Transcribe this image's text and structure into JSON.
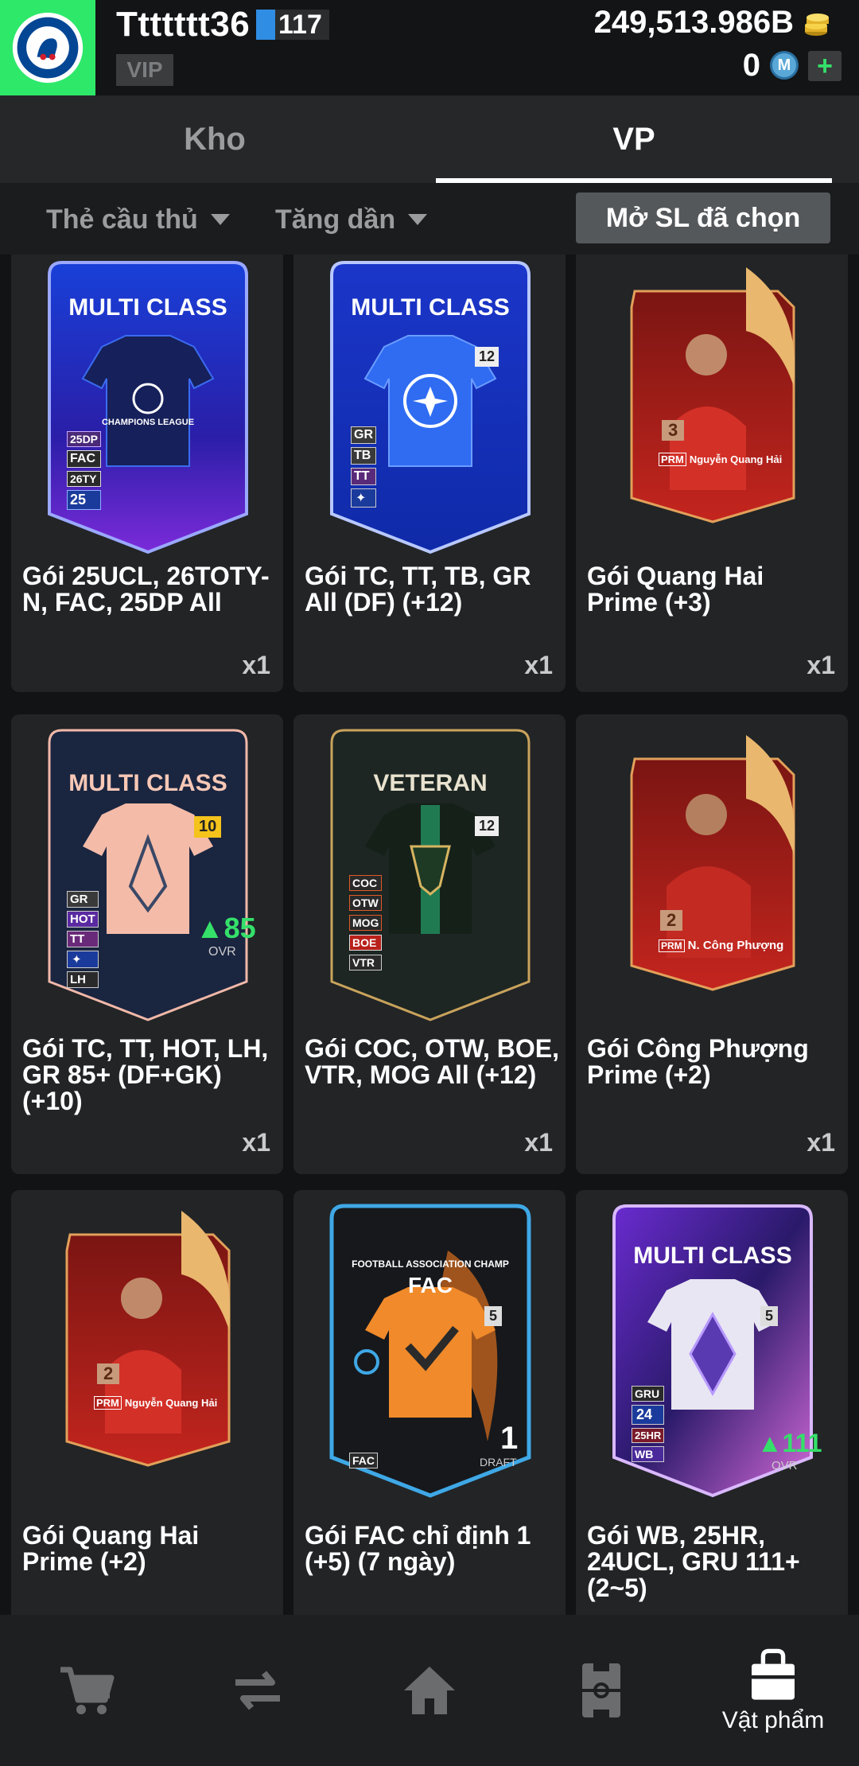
{
  "header": {
    "username": "Ttttttt36",
    "level": "117",
    "vip_label": "VIP",
    "coins": "249,513.986B",
    "mc_value": "0",
    "mc_icon_letter": "M",
    "club_badge": "chelsea-crest-icon"
  },
  "tabs": [
    {
      "label": "Kho",
      "active": false
    },
    {
      "label": "VP",
      "active": true
    }
  ],
  "filters": {
    "player_type": "Thẻ cầu thủ",
    "sort": "Tăng dần",
    "open_selected": "Mở SL đã chọn"
  },
  "packs": [
    {
      "title": "Gói 25UCL, 26TOTY-N, FAC, 25DP All",
      "qty": "x1",
      "card_label": "MULTI CLASS",
      "emblem_text": "CHAMPIONS LEAGUE",
      "tags": [
        "25DP",
        "FAC",
        "26TY",
        "25"
      ],
      "theme": "blue-purple"
    },
    {
      "title": "Gói TC, TT, TB, GR All (DF) (+12)",
      "qty": "x1",
      "card_label": "MULTI CLASS",
      "emblem_text": "CHAMPIONS",
      "level": "12",
      "tags": [
        "GR",
        "TB",
        "TT",
        "✦"
      ],
      "theme": "blue"
    },
    {
      "title": "Gói Quang Hai Prime (+3)",
      "qty": "x1",
      "level": "3",
      "player_name": "Nguyễn Quang Hải",
      "tag": "PRM",
      "theme": "red-prime"
    },
    {
      "title": "Gói TC, TT, HOT, LH, GR 85+ (DF+GK) (+10)",
      "qty": "x1",
      "card_label": "MULTI CLASS",
      "level": "10",
      "ovr": "85",
      "ovr_label": "OVR",
      "tags": [
        "GR",
        "HOT",
        "TT",
        "✦",
        "LH"
      ],
      "theme": "peach-navy"
    },
    {
      "title": "Gói COC, OTW, BOE, VTR, MOG All (+12)",
      "qty": "x1",
      "card_label": "VETERAN",
      "level": "12",
      "tags": [
        "COC",
        "OTW",
        "MOG",
        "BOE",
        "VTR"
      ],
      "theme": "green-gold"
    },
    {
      "title": "Gói Công Phượng Prime (+2)",
      "qty": "x1",
      "level": "2",
      "player_name": "N. Công Phượng",
      "tag": "PRM",
      "theme": "red-prime"
    },
    {
      "title": "Gói Quang Hai Prime (+2)",
      "qty": "",
      "level": "2",
      "player_name": "Nguyễn Quang Hải",
      "tag": "PRM",
      "theme": "red-prime"
    },
    {
      "title": "Gói FAC chỉ định 1 (+5) (7 ngày)",
      "qty": "",
      "card_label": "FAC",
      "card_sublabel": "FOOTBALL ASSOCIATION CHAMP",
      "level": "5",
      "draft_num": "1",
      "draft_label": "DRAFT",
      "tags": [
        "FAC"
      ],
      "theme": "orange-dark"
    },
    {
      "title": "Gói WB, 25HR, 24UCL, GRU 111+ (2~5)",
      "qty": "",
      "card_label": "MULTI CLASS",
      "level": "5",
      "ovr": "111",
      "ovr_label": "OVR",
      "tags": [
        "GRU",
        "24",
        "25HR",
        "WB"
      ],
      "theme": "purple"
    }
  ],
  "bottom_nav": [
    {
      "icon": "cart-icon",
      "label": ""
    },
    {
      "icon": "transfer-icon",
      "label": ""
    },
    {
      "icon": "home-icon",
      "label": ""
    },
    {
      "icon": "pitch-icon",
      "label": ""
    },
    {
      "icon": "bag-icon",
      "label": "Vật phẩm",
      "active": true
    }
  ],
  "colors": {
    "accent_green": "#2ee86a",
    "background": "#121314",
    "card_bg": "#222426",
    "ovr_green": "#35e06a"
  }
}
